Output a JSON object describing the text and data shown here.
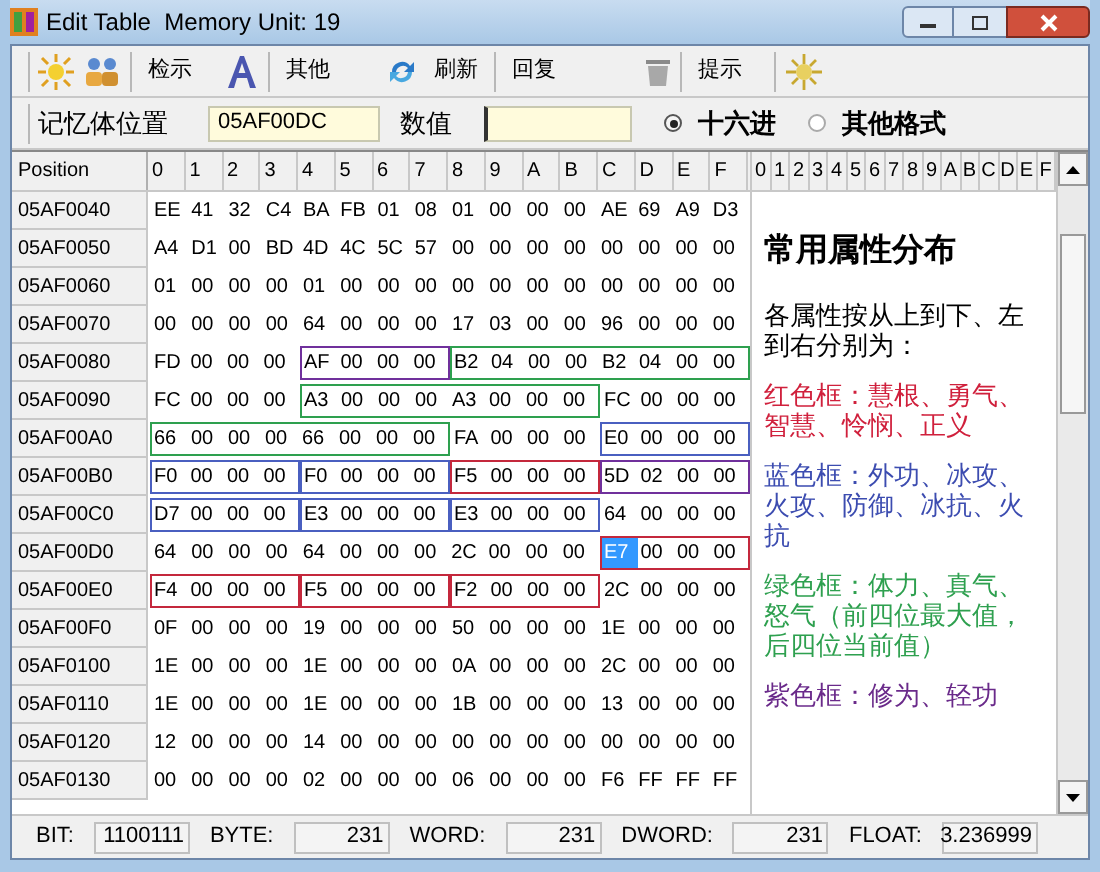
{
  "window": {
    "title": "Edit Table  Memory Unit: 19"
  },
  "toolbar": {
    "buttons": [
      "检示",
      "其他",
      "刷新",
      "回复",
      "提示"
    ]
  },
  "address_bar": {
    "label": "记忆体位置",
    "address": "05AF00DC",
    "value_label": "数值",
    "formats": [
      {
        "label": "十六进",
        "selected": true
      },
      {
        "label": "其他格式",
        "selected": false
      }
    ]
  },
  "grid": {
    "position_header": "Position",
    "hex_headers": [
      "0",
      "1",
      "2",
      "3",
      "4",
      "5",
      "6",
      "7",
      "8",
      "9",
      "A",
      "B",
      "C",
      "D",
      "E",
      "F"
    ],
    "text_headers": [
      "0",
      "1",
      "2",
      "3",
      "4",
      "5",
      "6",
      "7",
      "8",
      "9",
      "A",
      "B",
      "C",
      "D",
      "E",
      "F"
    ],
    "rows": [
      {
        "position": "05AF0040",
        "segments": [
          {
            "bytes": [
              {
                "text": "EE",
                "selected": false
              },
              {
                "text": "41",
                "selected": false
              },
              {
                "text": "32",
                "selected": false
              },
              {
                "text": "C4",
                "selected": false
              },
              {
                "text": "BA",
                "selected": false
              },
              {
                "text": "FB",
                "selected": false
              },
              {
                "text": "01",
                "selected": false
              },
              {
                "text": "08",
                "selected": false
              },
              {
                "text": "01",
                "selected": false
              },
              {
                "text": "00",
                "selected": false
              },
              {
                "text": "00",
                "selected": false
              },
              {
                "text": "00",
                "selected": false
              },
              {
                "text": "AE",
                "selected": false
              },
              {
                "text": "69",
                "selected": false
              },
              {
                "text": "A9",
                "selected": false
              },
              {
                "text": "D3",
                "selected": false
              }
            ]
          }
        ]
      },
      {
        "position": "05AF0050",
        "segments": [
          {
            "bytes": [
              {
                "text": "A4",
                "selected": false
              },
              {
                "text": "D1",
                "selected": false
              },
              {
                "text": "00",
                "selected": false
              },
              {
                "text": "BD",
                "selected": false
              },
              {
                "text": "4D",
                "selected": false
              },
              {
                "text": "4C",
                "selected": false
              },
              {
                "text": "5C",
                "selected": false
              },
              {
                "text": "57",
                "selected": false
              },
              {
                "text": "00",
                "selected": false
              },
              {
                "text": "00",
                "selected": false
              },
              {
                "text": "00",
                "selected": false
              },
              {
                "text": "00",
                "selected": false
              },
              {
                "text": "00",
                "selected": false
              },
              {
                "text": "00",
                "selected": false
              },
              {
                "text": "00",
                "selected": false
              },
              {
                "text": "00",
                "selected": false
              }
            ]
          }
        ]
      },
      {
        "position": "05AF0060",
        "segments": [
          {
            "bytes": [
              {
                "text": "01",
                "selected": false
              },
              {
                "text": "00",
                "selected": false
              },
              {
                "text": "00",
                "selected": false
              },
              {
                "text": "00",
                "selected": false
              },
              {
                "text": "01",
                "selected": false
              },
              {
                "text": "00",
                "selected": false
              },
              {
                "text": "00",
                "selected": false
              },
              {
                "text": "00",
                "selected": false
              },
              {
                "text": "00",
                "selected": false
              },
              {
                "text": "00",
                "selected": false
              },
              {
                "text": "00",
                "selected": false
              },
              {
                "text": "00",
                "selected": false
              },
              {
                "text": "00",
                "selected": false
              },
              {
                "text": "00",
                "selected": false
              },
              {
                "text": "00",
                "selected": false
              },
              {
                "text": "00",
                "selected": false
              }
            ]
          }
        ]
      },
      {
        "position": "05AF0070",
        "segments": [
          {
            "bytes": [
              {
                "text": "00",
                "selected": false
              },
              {
                "text": "00",
                "selected": false
              },
              {
                "text": "00",
                "selected": false
              },
              {
                "text": "00",
                "selected": false
              },
              {
                "text": "64",
                "selected": false
              },
              {
                "text": "00",
                "selected": false
              },
              {
                "text": "00",
                "selected": false
              },
              {
                "text": "00",
                "selected": false
              },
              {
                "text": "17",
                "selected": false
              },
              {
                "text": "03",
                "selected": false
              },
              {
                "text": "00",
                "selected": false
              },
              {
                "text": "00",
                "selected": false
              },
              {
                "text": "96",
                "selected": false
              },
              {
                "text": "00",
                "selected": false
              },
              {
                "text": "00",
                "selected": false
              },
              {
                "text": "00",
                "selected": false
              }
            ]
          }
        ]
      },
      {
        "position": "05AF0080",
        "segments": [
          {
            "bytes": [
              {
                "text": "FD",
                "selected": false
              },
              {
                "text": "00",
                "selected": false
              },
              {
                "text": "00",
                "selected": false
              },
              {
                "text": "00",
                "selected": false
              }
            ]
          },
          {
            "color": "#70309c",
            "bytes": [
              {
                "text": "AF",
                "selected": false
              },
              {
                "text": "00",
                "selected": false
              },
              {
                "text": "00",
                "selected": false
              },
              {
                "text": "00",
                "selected": false
              }
            ]
          },
          {
            "color": "#2ea04f",
            "bytes": [
              {
                "text": "B2",
                "selected": false
              },
              {
                "text": "04",
                "selected": false
              },
              {
                "text": "00",
                "selected": false
              },
              {
                "text": "00",
                "selected": false
              },
              {
                "text": "B2",
                "selected": false
              },
              {
                "text": "04",
                "selected": false
              },
              {
                "text": "00",
                "selected": false
              },
              {
                "text": "00",
                "selected": false
              }
            ]
          }
        ]
      },
      {
        "position": "05AF0090",
        "segments": [
          {
            "bytes": [
              {
                "text": "FC",
                "selected": false
              },
              {
                "text": "00",
                "selected": false
              },
              {
                "text": "00",
                "selected": false
              },
              {
                "text": "00",
                "selected": false
              }
            ]
          },
          {
            "color": "#2ea04f",
            "bytes": [
              {
                "text": "A3",
                "selected": false
              },
              {
                "text": "00",
                "selected": false
              },
              {
                "text": "00",
                "selected": false
              },
              {
                "text": "00",
                "selected": false
              },
              {
                "text": "A3",
                "selected": false
              },
              {
                "text": "00",
                "selected": false
              },
              {
                "text": "00",
                "selected": false
              },
              {
                "text": "00",
                "selected": false
              }
            ]
          },
          {
            "bytes": [
              {
                "text": "FC",
                "selected": false
              },
              {
                "text": "00",
                "selected": false
              },
              {
                "text": "00",
                "selected": false
              },
              {
                "text": "00",
                "selected": false
              }
            ]
          }
        ]
      },
      {
        "position": "05AF00A0",
        "segments": [
          {
            "color": "#2ea04f",
            "bytes": [
              {
                "text": "66",
                "selected": false
              },
              {
                "text": "00",
                "selected": false
              },
              {
                "text": "00",
                "selected": false
              },
              {
                "text": "00",
                "selected": false
              },
              {
                "text": "66",
                "selected": false
              },
              {
                "text": "00",
                "selected": false
              },
              {
                "text": "00",
                "selected": false
              },
              {
                "text": "00",
                "selected": false
              }
            ]
          },
          {
            "bytes": [
              {
                "text": "FA",
                "selected": false
              },
              {
                "text": "00",
                "selected": false
              },
              {
                "text": "00",
                "selected": false
              },
              {
                "text": "00",
                "selected": false
              }
            ]
          },
          {
            "color": "#4a5fc0",
            "bytes": [
              {
                "text": "E0",
                "selected": false
              },
              {
                "text": "00",
                "selected": false
              },
              {
                "text": "00",
                "selected": false
              },
              {
                "text": "00",
                "selected": false
              }
            ]
          }
        ]
      },
      {
        "position": "05AF00B0",
        "segments": [
          {
            "color": "#4a5fc0",
            "bytes": [
              {
                "text": "F0",
                "selected": false
              },
              {
                "text": "00",
                "selected": false
              },
              {
                "text": "00",
                "selected": false
              },
              {
                "text": "00",
                "selected": false
              }
            ]
          },
          {
            "color": "#4a5fc0",
            "bytes": [
              {
                "text": "F0",
                "selected": false
              },
              {
                "text": "00",
                "selected": false
              },
              {
                "text": "00",
                "selected": false
              },
              {
                "text": "00",
                "selected": false
              }
            ]
          },
          {
            "color": "#c4283c",
            "bytes": [
              {
                "text": "F5",
                "selected": false
              },
              {
                "text": "00",
                "selected": false
              },
              {
                "text": "00",
                "selected": false
              },
              {
                "text": "00",
                "selected": false
              }
            ]
          },
          {
            "color": "#70309c",
            "bytes": [
              {
                "text": "5D",
                "selected": false
              },
              {
                "text": "02",
                "selected": false
              },
              {
                "text": "00",
                "selected": false
              },
              {
                "text": "00",
                "selected": false
              }
            ]
          }
        ]
      },
      {
        "position": "05AF00C0",
        "segments": [
          {
            "color": "#4a5fc0",
            "bytes": [
              {
                "text": "D7",
                "selected": false
              },
              {
                "text": "00",
                "selected": false
              },
              {
                "text": "00",
                "selected": false
              },
              {
                "text": "00",
                "selected": false
              }
            ]
          },
          {
            "color": "#4a5fc0",
            "bytes": [
              {
                "text": "E3",
                "selected": false
              },
              {
                "text": "00",
                "selected": false
              },
              {
                "text": "00",
                "selected": false
              },
              {
                "text": "00",
                "selected": false
              }
            ]
          },
          {
            "color": "#4a5fc0",
            "bytes": [
              {
                "text": "E3",
                "selected": false
              },
              {
                "text": "00",
                "selected": false
              },
              {
                "text": "00",
                "selected": false
              },
              {
                "text": "00",
                "selected": false
              }
            ]
          },
          {
            "bytes": [
              {
                "text": "64",
                "selected": false
              },
              {
                "text": "00",
                "selected": false
              },
              {
                "text": "00",
                "selected": false
              },
              {
                "text": "00",
                "selected": false
              }
            ]
          }
        ]
      },
      {
        "position": "05AF00D0",
        "segments": [
          {
            "bytes": [
              {
                "text": "64",
                "selected": false
              },
              {
                "text": "00",
                "selected": false
              },
              {
                "text": "00",
                "selected": false
              },
              {
                "text": "00",
                "selected": false
              },
              {
                "text": "64",
                "selected": false
              },
              {
                "text": "00",
                "selected": false
              },
              {
                "text": "00",
                "selected": false
              },
              {
                "text": "00",
                "selected": false
              },
              {
                "text": "2C",
                "selected": false
              },
              {
                "text": "00",
                "selected": false
              },
              {
                "text": "00",
                "selected": false
              },
              {
                "text": "00",
                "selected": false
              }
            ]
          },
          {
            "color": "#c4283c",
            "bytes": [
              {
                "text": "E7",
                "selected": true
              },
              {
                "text": "00",
                "selected": false
              },
              {
                "text": "00",
                "selected": false
              },
              {
                "text": "00",
                "selected": false
              }
            ]
          }
        ]
      },
      {
        "position": "05AF00E0",
        "segments": [
          {
            "color": "#c4283c",
            "bytes": [
              {
                "text": "F4",
                "selected": false
              },
              {
                "text": "00",
                "selected": false
              },
              {
                "text": "00",
                "selected": false
              },
              {
                "text": "00",
                "selected": false
              }
            ]
          },
          {
            "color": "#c4283c",
            "bytes": [
              {
                "text": "F5",
                "selected": false
              },
              {
                "text": "00",
                "selected": false
              },
              {
                "text": "00",
                "selected": false
              },
              {
                "text": "00",
                "selected": false
              }
            ]
          },
          {
            "color": "#c4283c",
            "bytes": [
              {
                "text": "F2",
                "selected": false
              },
              {
                "text": "00",
                "selected": false
              },
              {
                "text": "00",
                "selected": false
              },
              {
                "text": "00",
                "selected": false
              }
            ]
          },
          {
            "bytes": [
              {
                "text": "2C",
                "selected": false
              },
              {
                "text": "00",
                "selected": false
              },
              {
                "text": "00",
                "selected": false
              },
              {
                "text": "00",
                "selected": false
              }
            ]
          }
        ]
      },
      {
        "position": "05AF00F0",
        "segments": [
          {
            "bytes": [
              {
                "text": "0F",
                "selected": false
              },
              {
                "text": "00",
                "selected": false
              },
              {
                "text": "00",
                "selected": false
              },
              {
                "text": "00",
                "selected": false
              },
              {
                "text": "19",
                "selected": false
              },
              {
                "text": "00",
                "selected": false
              },
              {
                "text": "00",
                "selected": false
              },
              {
                "text": "00",
                "selected": false
              },
              {
                "text": "50",
                "selected": false
              },
              {
                "text": "00",
                "selected": false
              },
              {
                "text": "00",
                "selected": false
              },
              {
                "text": "00",
                "selected": false
              },
              {
                "text": "1E",
                "selected": false
              },
              {
                "text": "00",
                "selected": false
              },
              {
                "text": "00",
                "selected": false
              },
              {
                "text": "00",
                "selected": false
              }
            ]
          }
        ]
      },
      {
        "position": "05AF0100",
        "segments": [
          {
            "bytes": [
              {
                "text": "1E",
                "selected": false
              },
              {
                "text": "00",
                "selected": false
              },
              {
                "text": "00",
                "selected": false
              },
              {
                "text": "00",
                "selected": false
              },
              {
                "text": "1E",
                "selected": false
              },
              {
                "text": "00",
                "selected": false
              },
              {
                "text": "00",
                "selected": false
              },
              {
                "text": "00",
                "selected": false
              },
              {
                "text": "0A",
                "selected": false
              },
              {
                "text": "00",
                "selected": false
              },
              {
                "text": "00",
                "selected": false
              },
              {
                "text": "00",
                "selected": false
              },
              {
                "text": "2C",
                "selected": false
              },
              {
                "text": "00",
                "selected": false
              },
              {
                "text": "00",
                "selected": false
              },
              {
                "text": "00",
                "selected": false
              }
            ]
          }
        ]
      },
      {
        "position": "05AF0110",
        "segments": [
          {
            "bytes": [
              {
                "text": "1E",
                "selected": false
              },
              {
                "text": "00",
                "selected": false
              },
              {
                "text": "00",
                "selected": false
              },
              {
                "text": "00",
                "selected": false
              },
              {
                "text": "1E",
                "selected": false
              },
              {
                "text": "00",
                "selected": false
              },
              {
                "text": "00",
                "selected": false
              },
              {
                "text": "00",
                "selected": false
              },
              {
                "text": "1B",
                "selected": false
              },
              {
                "text": "00",
                "selected": false
              },
              {
                "text": "00",
                "selected": false
              },
              {
                "text": "00",
                "selected": false
              },
              {
                "text": "13",
                "selected": false
              },
              {
                "text": "00",
                "selected": false
              },
              {
                "text": "00",
                "selected": false
              },
              {
                "text": "00",
                "selected": false
              }
            ]
          }
        ]
      },
      {
        "position": "05AF0120",
        "segments": [
          {
            "bytes": [
              {
                "text": "12",
                "selected": false
              },
              {
                "text": "00",
                "selected": false
              },
              {
                "text": "00",
                "selected": false
              },
              {
                "text": "00",
                "selected": false
              },
              {
                "text": "14",
                "selected": false
              },
              {
                "text": "00",
                "selected": false
              },
              {
                "text": "00",
                "selected": false
              },
              {
                "text": "00",
                "selected": false
              },
              {
                "text": "00",
                "selected": false
              },
              {
                "text": "00",
                "selected": false
              },
              {
                "text": "00",
                "selected": false
              },
              {
                "text": "00",
                "selected": false
              },
              {
                "text": "00",
                "selected": false
              },
              {
                "text": "00",
                "selected": false
              },
              {
                "text": "00",
                "selected": false
              },
              {
                "text": "00",
                "selected": false
              }
            ]
          }
        ]
      },
      {
        "position": "05AF0130",
        "segments": [
          {
            "bytes": [
              {
                "text": "00",
                "selected": false
              },
              {
                "text": "00",
                "selected": false
              },
              {
                "text": "00",
                "selected": false
              },
              {
                "text": "00",
                "selected": false
              },
              {
                "text": "02",
                "selected": false
              },
              {
                "text": "00",
                "selected": false
              },
              {
                "text": "00",
                "selected": false
              },
              {
                "text": "00",
                "selected": false
              },
              {
                "text": "06",
                "selected": false
              },
              {
                "text": "00",
                "selected": false
              },
              {
                "text": "00",
                "selected": false
              },
              {
                "text": "00",
                "selected": false
              },
              {
                "text": "F6",
                "selected": false
              },
              {
                "text": "FF",
                "selected": false
              },
              {
                "text": "FF",
                "selected": false
              },
              {
                "text": "FF",
                "selected": false
              }
            ]
          }
        ]
      }
    ]
  },
  "notes": {
    "title": "常用属性分布",
    "intro": "各属性按从上到下、左到右分别为：",
    "items": [
      {
        "text": "红色框：慧根、勇气、智慧、怜悯、正义",
        "color": "#d0203c"
      },
      {
        "text": "蓝色框：外功、冰攻、火攻、防御、冰抗、火抗",
        "color": "#3c4cb0"
      },
      {
        "text": "绿色框：体力、真气、怒气（前四位最大值，后四位当前值）",
        "color": "#2ea04f"
      },
      {
        "text": "紫色框：修为、轻功",
        "color": "#6a2a8a"
      }
    ]
  },
  "status_bar": [
    {
      "label": "BIT:",
      "value": "1100111"
    },
    {
      "label": "BYTE:",
      "value": "231"
    },
    {
      "label": "WORD:",
      "value": "231"
    },
    {
      "label": "DWORD:",
      "value": "231"
    },
    {
      "label": "FLOAT:",
      "value": "3.236999"
    }
  ]
}
